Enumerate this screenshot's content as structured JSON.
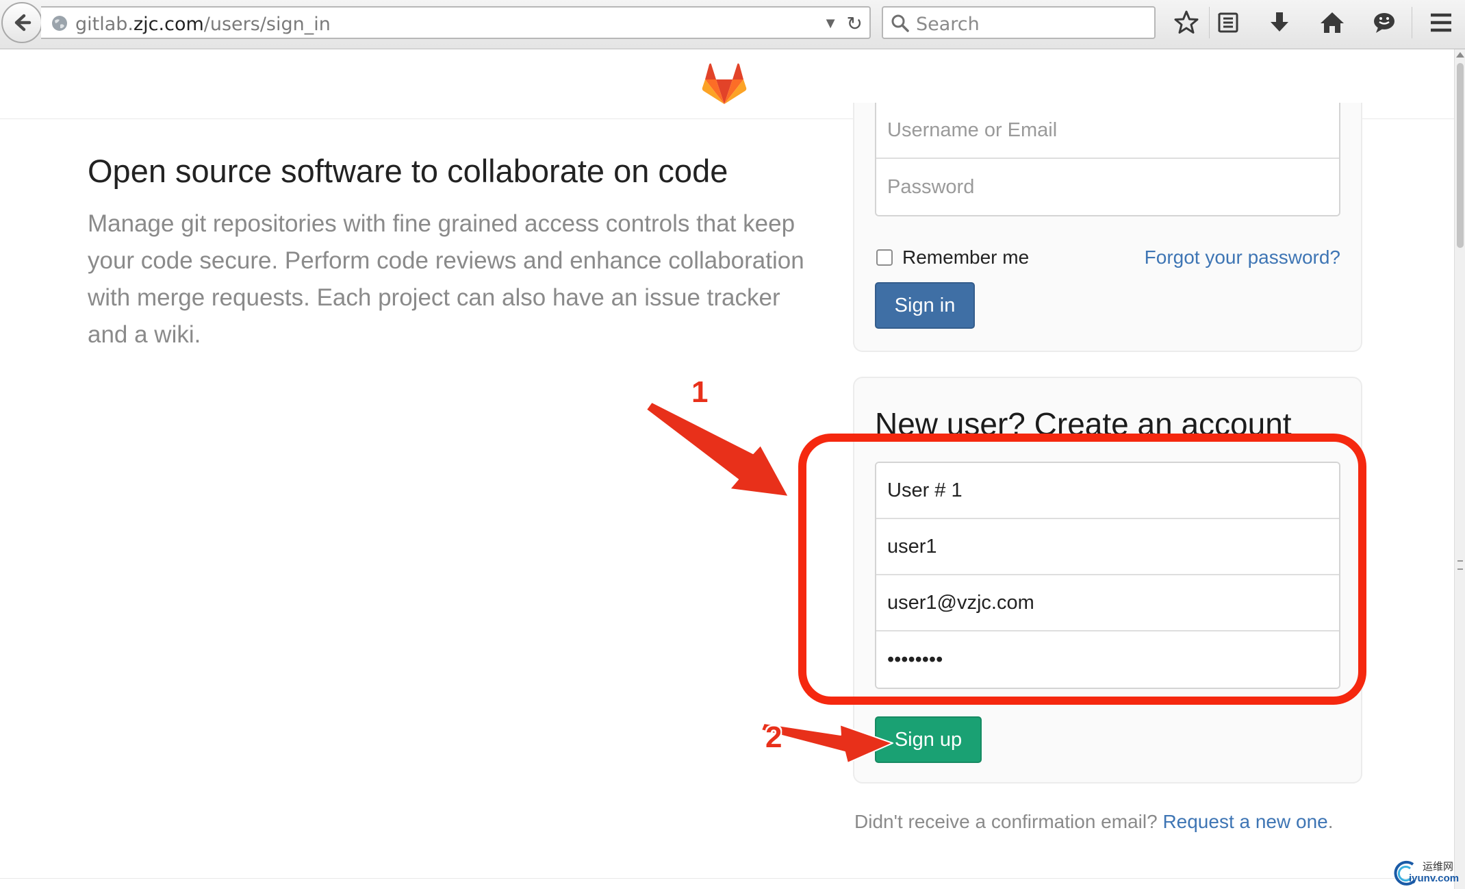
{
  "browser": {
    "url_prefix": "gitlab.",
    "url_domain": "zjc.com",
    "url_path": "/users/sign_in",
    "search_placeholder": "Search"
  },
  "hero": {
    "title": "Open source software to collaborate on code",
    "text": "Manage git repositories with fine grained access controls that keep your code secure. Perform code reviews and enhance collaboration with merge requests. Each project can also have an issue tracker and a wiki."
  },
  "signin": {
    "login_placeholder": "Username or Email",
    "password_placeholder": "Password",
    "remember_label": "Remember me",
    "remember_checked": false,
    "forgot_link": "Forgot your password?",
    "submit_label": "Sign in"
  },
  "signup": {
    "title": "New user? Create an account",
    "name_value": "User # 1",
    "username_value": "user1",
    "email_value": "user1@vzjc.com",
    "password_value": "••••••••",
    "submit_label": "Sign up"
  },
  "confirmation": {
    "text": "Didn't receive a confirmation email?",
    "link": "Request a new one",
    "suffix": "."
  },
  "annotations": {
    "step1": "1",
    "step2": "2",
    "highlight_color": "#f5280f",
    "arrow_color": "#e8301a"
  },
  "watermark": {
    "line1": "运维网",
    "line2": "iyunv.com"
  },
  "colors": {
    "signin_button": "#3f6fa5",
    "signup_button": "#1aa173",
    "link": "#3e75b4"
  }
}
